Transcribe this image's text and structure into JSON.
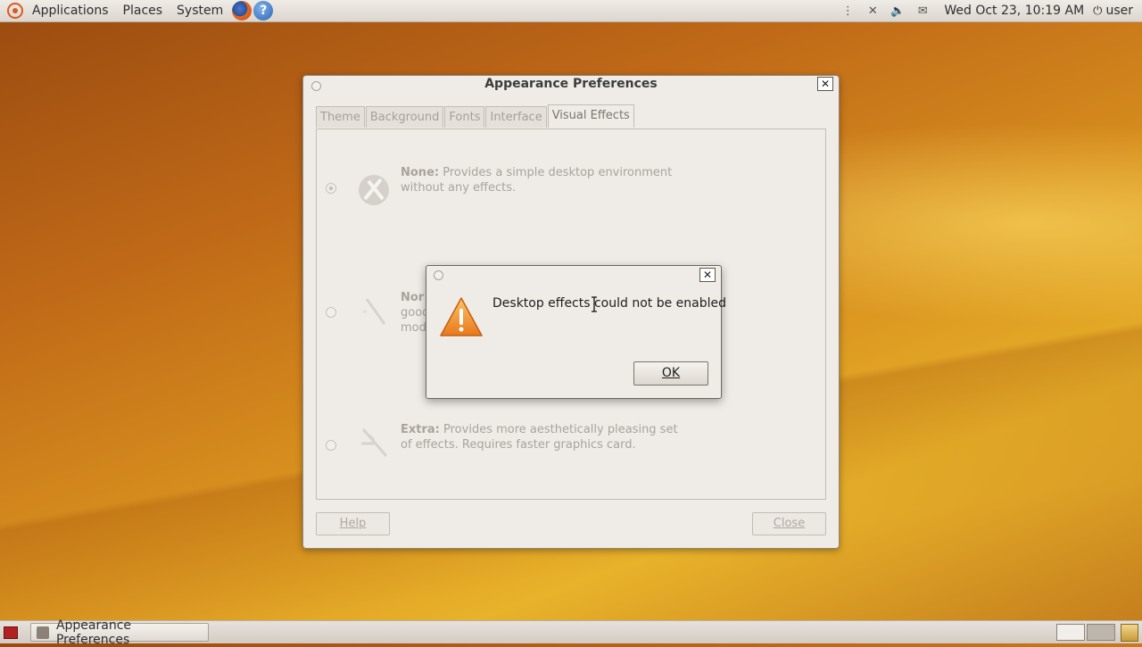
{
  "top_panel": {
    "menus": [
      "Applications",
      "Places",
      "System"
    ],
    "launchers": {
      "help_label": "?"
    },
    "clock": "Wed Oct 23, 10:19 AM",
    "user": "user"
  },
  "window": {
    "title": "Appearance Preferences",
    "close_label": "✕",
    "tabs": [
      "Theme",
      "Background",
      "Fonts",
      "Interface",
      "Visual Effects"
    ],
    "active_tab": "Visual Effects",
    "effects": [
      {
        "name": "None:",
        "description": "Provides a simple desktop environment without any effects."
      },
      {
        "name": "Nor",
        "description": "good mod"
      },
      {
        "name": "Extra:",
        "description": "Provides more aesthetically pleasing set of effects. Requires faster graphics card."
      }
    ],
    "help_label": "Help",
    "close_button_label": "Close"
  },
  "dialog": {
    "message": "Desktop effects could not be enabled",
    "ok_label": "OK",
    "close_label": "✕",
    "icon": "warning-icon"
  },
  "bottom_panel": {
    "task_label": "Appearance Preferences"
  },
  "colors": {
    "panel_bg": "#dcd6cf",
    "window_bg": "#efebe7",
    "warning_orange": "#f08a1c",
    "ubuntu_orange": "#d95b1f"
  }
}
